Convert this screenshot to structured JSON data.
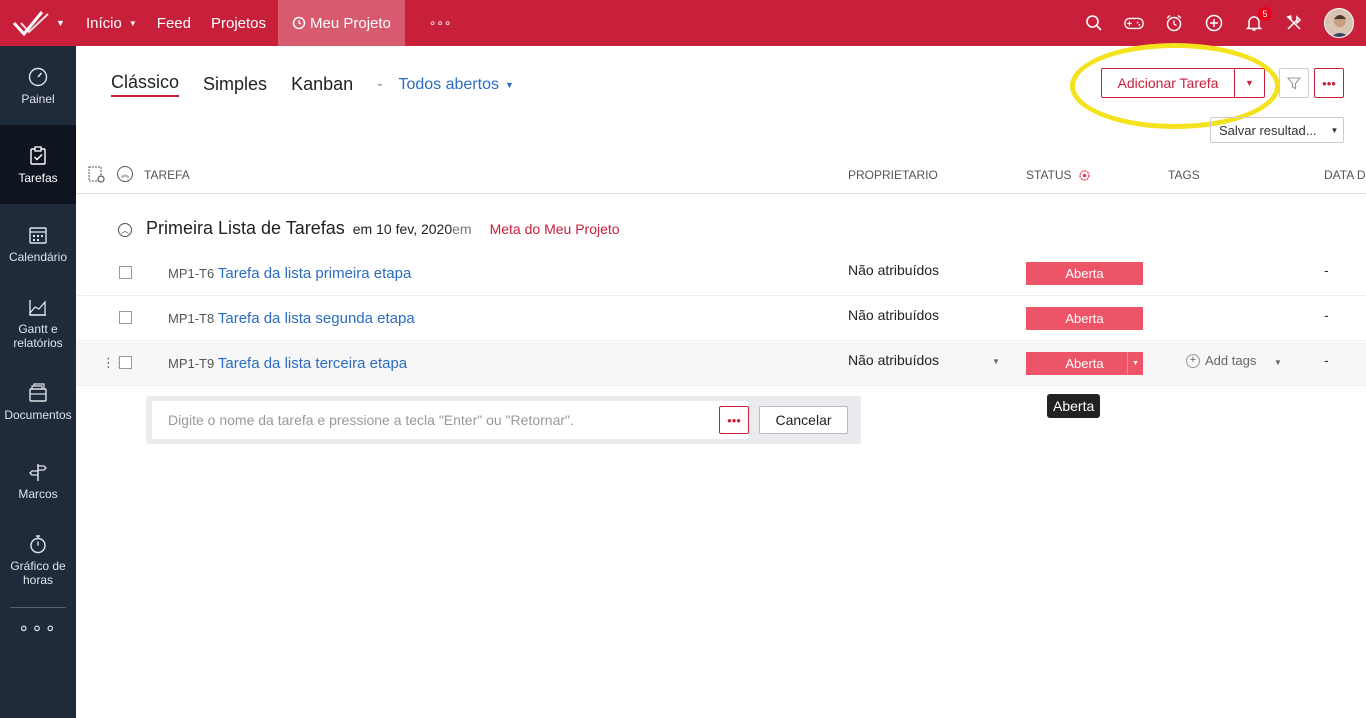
{
  "topbar": {
    "nav": [
      {
        "label": "Início",
        "has_caret": true
      },
      {
        "label": "Feed"
      },
      {
        "label": "Projetos"
      }
    ],
    "active_project": "Meu Projeto",
    "more": "∘∘∘",
    "notifications_count": "5",
    "colors": {
      "brand": "#c8203b"
    }
  },
  "sidebar": {
    "items": [
      {
        "label": "Painel"
      },
      {
        "label": "Tarefas"
      },
      {
        "label": "Calendário"
      },
      {
        "label": "Gantt e relatórios"
      },
      {
        "label": "Documentos"
      },
      {
        "label": "Marcos"
      },
      {
        "label": "Gráfico de horas"
      }
    ],
    "more": "∘∘∘"
  },
  "views": {
    "tabs": [
      "Clássico",
      "Simples",
      "Kanban"
    ],
    "active_tab": "Clássico",
    "separator": "-",
    "filter": "Todos abertos"
  },
  "toolbar": {
    "add_task": "Adicionar Tarefa",
    "more": "•••",
    "save_results": "Salvar resultad..."
  },
  "table": {
    "columns": {
      "task": "TAREFA",
      "owner": "PROPRIETARIO",
      "status": "STATUS",
      "tags": "TAGS",
      "due": "DATA D"
    }
  },
  "group": {
    "title": "Primeira Lista de Tarefas",
    "date": "em 10 fev, 2020",
    "em": "em",
    "milestone": "Meta do Meu Projeto"
  },
  "tasks": [
    {
      "id": "MP1-T6",
      "name": "Tarefa da lista primeira etapa",
      "owner": "Não atribuídos",
      "status": "Aberta",
      "due": "-"
    },
    {
      "id": "MP1-T8",
      "name": "Tarefa da lista segunda etapa",
      "owner": "Não atribuídos",
      "status": "Aberta",
      "due": "-"
    },
    {
      "id": "MP1-T9",
      "name": "Tarefa da lista terceira etapa",
      "owner": "Não atribuídos",
      "status": "Aberta",
      "due": "-",
      "add_tags": "Add tags"
    }
  ],
  "new_task": {
    "placeholder": "Digite o nome da tarefa e pressione a tecla \"Enter\" ou \"Retornar\".",
    "more": "•••",
    "cancel": "Cancelar"
  },
  "tooltip": "Aberta"
}
